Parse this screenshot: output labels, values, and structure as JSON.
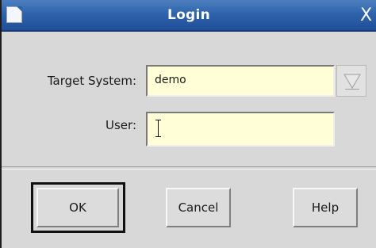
{
  "window": {
    "title": "Login",
    "close_glyph": "X"
  },
  "form": {
    "target_system": {
      "label": "Target System:",
      "value": "demo"
    },
    "user": {
      "label": "User:",
      "value": ""
    }
  },
  "buttons": {
    "ok": "OK",
    "cancel": "Cancel",
    "help": "Help"
  },
  "colors": {
    "title_bar": "#2f64ad",
    "field_background": "#fffed6",
    "dialog_background": "#d8d8d8"
  },
  "icons": {
    "window_menu": "window-icon",
    "dropdown": "triangle-down-icon",
    "cursor": "text-cursor-icon"
  }
}
